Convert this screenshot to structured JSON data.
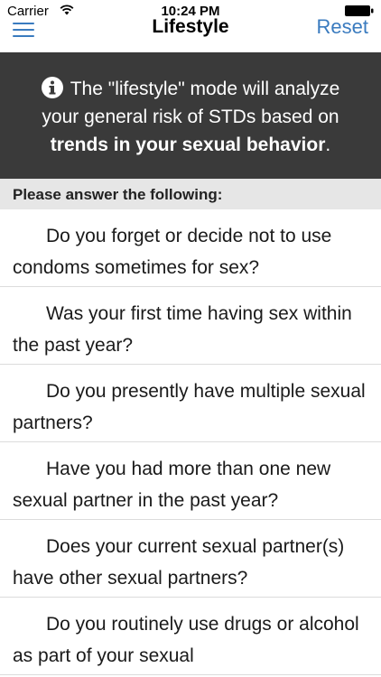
{
  "status_bar": {
    "carrier": "Carrier",
    "time": "10:24 PM"
  },
  "nav": {
    "title": "Lifestyle",
    "reset_label": "Reset",
    "menu_icon": "hamburger-menu-icon"
  },
  "banner": {
    "text_before": "The \"lifestyle\" mode will analyze your general risk of STDs based on ",
    "text_bold": "trends in your sexual behavior",
    "text_after": ".",
    "icon": "info-icon"
  },
  "section": {
    "header": "Please answer the following:"
  },
  "questions": [
    "Do you forget or decide not to use condoms sometimes for sex?",
    "Was your first time having sex within the past year?",
    "Do you presently have multiple sexual partners?",
    "Have you had more than one new sexual partner in the past year?",
    "Does your current sexual partner(s) have other sexual partners?",
    "Do you routinely use drugs or alcohol as part of your sexual"
  ],
  "colors": {
    "accent": "#3a7bbf",
    "banner_bg": "#3a3a3a",
    "section_bg": "#e6e6e6"
  }
}
